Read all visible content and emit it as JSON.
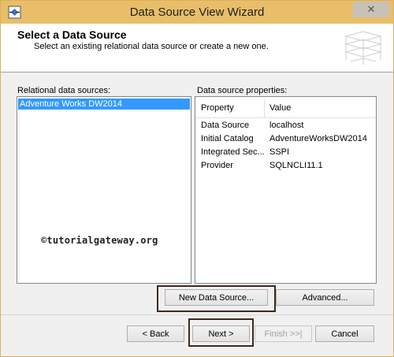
{
  "window": {
    "title": "Data Source View Wizard",
    "close_glyph": "✕"
  },
  "header": {
    "title": "Select a Data Source",
    "subtitle": "Select an existing relational data source or create a new one."
  },
  "relational_sources": {
    "label": "Relational data sources:",
    "items": [
      "Adventure Works DW2014"
    ]
  },
  "properties": {
    "label": "Data source properties:",
    "columns": [
      "Property",
      "Value"
    ],
    "rows": [
      {
        "name": "Data Source",
        "value": "localhost"
      },
      {
        "name": "Initial Catalog",
        "value": "AdventureWorksDW2014"
      },
      {
        "name": "Integrated Sec...",
        "value": "SSPI"
      },
      {
        "name": "Provider",
        "value": "SQLNCLI11.1"
      }
    ]
  },
  "watermark": "©tutorialgateway.org",
  "buttons": {
    "new_data_source": "New Data Source...",
    "advanced": "Advanced...",
    "back": "< Back",
    "next": "Next >",
    "finish": "Finish >>|",
    "cancel": "Cancel"
  },
  "colors": {
    "titlebar": "#e9be6a",
    "selection": "#3399ff",
    "highlight_box": "#3c2a1e"
  }
}
